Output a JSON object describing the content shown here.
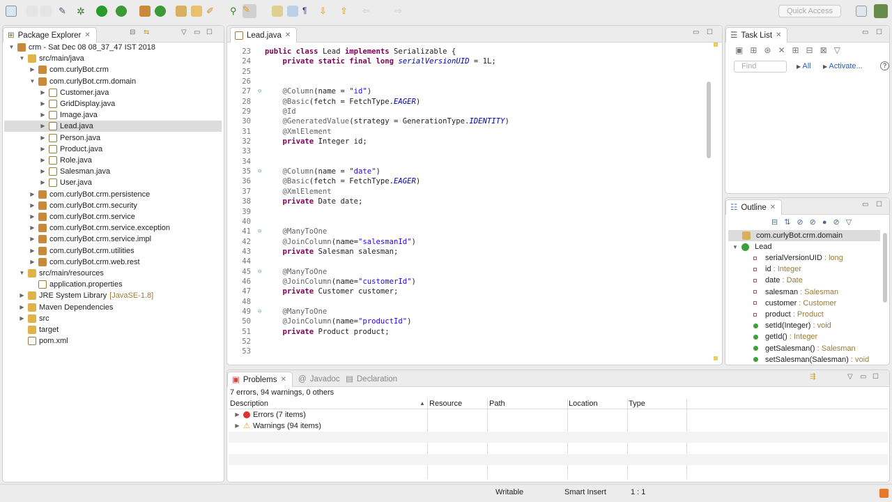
{
  "toolbar": {
    "quick_access": "Quick Access"
  },
  "package_explorer": {
    "title": "Package Explorer",
    "items": [
      {
        "label": "crm - Sat Dec 08 08_37_47 IST 2018",
        "depth": 0,
        "tw": "▼",
        "icon": "project"
      },
      {
        "label": "src/main/java",
        "depth": 1,
        "tw": "▼",
        "icon": "folder"
      },
      {
        "label": "com.curlyBot.crm",
        "depth": 2,
        "tw": "▶",
        "icon": "package"
      },
      {
        "label": "com.curlyBot.crm.domain",
        "depth": 2,
        "tw": "▼",
        "icon": "package"
      },
      {
        "label": "Customer.java",
        "depth": 3,
        "tw": "▶",
        "icon": "java"
      },
      {
        "label": "GridDisplay.java",
        "depth": 3,
        "tw": "▶",
        "icon": "java"
      },
      {
        "label": "Image.java",
        "depth": 3,
        "tw": "▶",
        "icon": "java"
      },
      {
        "label": "Lead.java",
        "depth": 3,
        "tw": "▶",
        "icon": "java",
        "selected": true
      },
      {
        "label": "Person.java",
        "depth": 3,
        "tw": "▶",
        "icon": "java"
      },
      {
        "label": "Product.java",
        "depth": 3,
        "tw": "▶",
        "icon": "java"
      },
      {
        "label": "Role.java",
        "depth": 3,
        "tw": "▶",
        "icon": "java"
      },
      {
        "label": "Salesman.java",
        "depth": 3,
        "tw": "▶",
        "icon": "java"
      },
      {
        "label": "User.java",
        "depth": 3,
        "tw": "▶",
        "icon": "java"
      },
      {
        "label": "com.curlyBot.crm.persistence",
        "depth": 2,
        "tw": "▶",
        "icon": "package"
      },
      {
        "label": "com.curlyBot.crm.security",
        "depth": 2,
        "tw": "▶",
        "icon": "package"
      },
      {
        "label": "com.curlyBot.crm.service",
        "depth": 2,
        "tw": "▶",
        "icon": "package"
      },
      {
        "label": "com.curlyBot.crm.service.exception",
        "depth": 2,
        "tw": "▶",
        "icon": "package"
      },
      {
        "label": "com.curlyBot.crm.service.impl",
        "depth": 2,
        "tw": "▶",
        "icon": "package"
      },
      {
        "label": "com.curlyBot.crm.utilities",
        "depth": 2,
        "tw": "▶",
        "icon": "package"
      },
      {
        "label": "com.curlyBot.crm.web.rest",
        "depth": 2,
        "tw": "▶",
        "icon": "package"
      },
      {
        "label": "src/main/resources",
        "depth": 1,
        "tw": "▼",
        "icon": "folder"
      },
      {
        "label": "application.properties",
        "depth": 2,
        "tw": "",
        "icon": "file"
      },
      {
        "label": "JRE System Library",
        "suffix": "[JavaSE-1.8]",
        "depth": 1,
        "tw": "▶",
        "icon": "library"
      },
      {
        "label": "Maven Dependencies",
        "depth": 1,
        "tw": "▶",
        "icon": "library"
      },
      {
        "label": "src",
        "depth": 1,
        "tw": "▶",
        "icon": "folder"
      },
      {
        "label": "target",
        "depth": 1,
        "tw": "",
        "icon": "folder"
      },
      {
        "label": "pom.xml",
        "depth": 1,
        "tw": "",
        "icon": "file"
      }
    ]
  },
  "editor": {
    "tab": "Lead.java",
    "lines": [
      {
        "n": "23",
        "seg": [
          [
            "public",
            "k"
          ],
          [
            " "
          ],
          [
            "class",
            "k"
          ],
          [
            " Lead "
          ],
          [
            "implements",
            "k"
          ],
          [
            " Serializable {"
          ]
        ]
      },
      {
        "n": "24",
        "seg": [
          [
            "    "
          ],
          [
            "private",
            "k"
          ],
          [
            " "
          ],
          [
            "static",
            "k"
          ],
          [
            " "
          ],
          [
            "final",
            "k"
          ],
          [
            " "
          ],
          [
            "long",
            "k"
          ],
          [
            " "
          ],
          [
            "serialVersionUID",
            "f"
          ],
          [
            " = 1L;"
          ]
        ]
      },
      {
        "n": "25",
        "seg": []
      },
      {
        "n": "26",
        "seg": []
      },
      {
        "n": "27",
        "fold": true,
        "seg": [
          [
            "    "
          ],
          [
            "@Column",
            "a"
          ],
          [
            "(name = "
          ],
          [
            "\"id\"",
            "s"
          ],
          [
            ")"
          ]
        ]
      },
      {
        "n": "28",
        "seg": [
          [
            "    "
          ],
          [
            "@Basic",
            "a"
          ],
          [
            "(fetch = FetchType."
          ],
          [
            "EAGER",
            "f"
          ],
          [
            ")"
          ]
        ]
      },
      {
        "n": "29",
        "seg": [
          [
            "    "
          ],
          [
            "@Id",
            "a"
          ]
        ]
      },
      {
        "n": "30",
        "seg": [
          [
            "    "
          ],
          [
            "@GeneratedValue",
            "a"
          ],
          [
            "(strategy = GenerationType."
          ],
          [
            "IDENTITY",
            "f"
          ],
          [
            ")"
          ]
        ]
      },
      {
        "n": "31",
        "seg": [
          [
            "    "
          ],
          [
            "@XmlElement",
            "a"
          ]
        ]
      },
      {
        "n": "32",
        "seg": [
          [
            "    "
          ],
          [
            "private",
            "k"
          ],
          [
            " Integer id;"
          ]
        ]
      },
      {
        "n": "33",
        "seg": []
      },
      {
        "n": "34",
        "seg": []
      },
      {
        "n": "35",
        "fold": true,
        "seg": [
          [
            "    "
          ],
          [
            "@Column",
            "a"
          ],
          [
            "(name = "
          ],
          [
            "\"date\"",
            "s"
          ],
          [
            ")"
          ]
        ]
      },
      {
        "n": "36",
        "seg": [
          [
            "    "
          ],
          [
            "@Basic",
            "a"
          ],
          [
            "(fetch = FetchType."
          ],
          [
            "EAGER",
            "f"
          ],
          [
            ")"
          ]
        ]
      },
      {
        "n": "37",
        "seg": [
          [
            "    "
          ],
          [
            "@XmlElement",
            "a"
          ]
        ]
      },
      {
        "n": "38",
        "seg": [
          [
            "    "
          ],
          [
            "private",
            "k"
          ],
          [
            " Date date;"
          ]
        ]
      },
      {
        "n": "39",
        "seg": []
      },
      {
        "n": "40",
        "seg": []
      },
      {
        "n": "41",
        "fold": true,
        "seg": [
          [
            "    "
          ],
          [
            "@ManyToOne",
            "a"
          ]
        ]
      },
      {
        "n": "42",
        "seg": [
          [
            "    "
          ],
          [
            "@JoinColumn",
            "a"
          ],
          [
            "(name="
          ],
          [
            "\"salesmanId\"",
            "s"
          ],
          [
            ")"
          ]
        ]
      },
      {
        "n": "43",
        "seg": [
          [
            "    "
          ],
          [
            "private",
            "k"
          ],
          [
            " Salesman salesman;"
          ]
        ]
      },
      {
        "n": "44",
        "seg": []
      },
      {
        "n": "45",
        "fold": true,
        "seg": [
          [
            "    "
          ],
          [
            "@ManyToOne",
            "a"
          ]
        ]
      },
      {
        "n": "46",
        "seg": [
          [
            "    "
          ],
          [
            "@JoinColumn",
            "a"
          ],
          [
            "(name="
          ],
          [
            "\"customerId\"",
            "s"
          ],
          [
            ")"
          ]
        ]
      },
      {
        "n": "47",
        "seg": [
          [
            "    "
          ],
          [
            "private",
            "k"
          ],
          [
            " Customer customer;"
          ]
        ]
      },
      {
        "n": "48",
        "seg": []
      },
      {
        "n": "49",
        "fold": true,
        "seg": [
          [
            "    "
          ],
          [
            "@ManyToOne",
            "a"
          ]
        ]
      },
      {
        "n": "50",
        "seg": [
          [
            "    "
          ],
          [
            "@JoinColumn",
            "a"
          ],
          [
            "(name="
          ],
          [
            "\"productId\"",
            "s"
          ],
          [
            ")"
          ]
        ]
      },
      {
        "n": "51",
        "seg": [
          [
            "    "
          ],
          [
            "private",
            "k"
          ],
          [
            " Product product;"
          ]
        ]
      },
      {
        "n": "52",
        "seg": []
      },
      {
        "n": "53",
        "seg": []
      }
    ]
  },
  "task_list": {
    "title": "Task List",
    "find_placeholder": "Find",
    "all": "All",
    "activate": "Activate..."
  },
  "outline": {
    "title": "Outline",
    "package": "com.curlyBot.crm.domain",
    "class": "Lead",
    "members": [
      {
        "name": "serialVersionUID",
        "type": "long",
        "kind": "static-field"
      },
      {
        "name": "id",
        "type": "Integer",
        "kind": "field"
      },
      {
        "name": "date",
        "type": "Date",
        "kind": "field"
      },
      {
        "name": "salesman",
        "type": "Salesman",
        "kind": "field"
      },
      {
        "name": "customer",
        "type": "Customer",
        "kind": "field"
      },
      {
        "name": "product",
        "type": "Product",
        "kind": "field"
      },
      {
        "name": "setId(Integer)",
        "type": "void",
        "kind": "method"
      },
      {
        "name": "getId()",
        "type": "Integer",
        "kind": "method"
      },
      {
        "name": "getSalesman()",
        "type": "Salesman",
        "kind": "method"
      },
      {
        "name": "setSalesman(Salesman)",
        "type": "void",
        "kind": "method"
      }
    ]
  },
  "problems": {
    "tabs": [
      "Problems",
      "Javadoc",
      "Declaration"
    ],
    "summary": "7 errors, 94 warnings, 0 others",
    "columns": [
      "Description",
      "Resource",
      "Path",
      "Location",
      "Type"
    ],
    "rows": [
      "Errors (7 items)",
      "Warnings (94 items)"
    ]
  },
  "status": {
    "writable": "Writable",
    "insert": "Smart Insert",
    "position": "1 : 1"
  }
}
